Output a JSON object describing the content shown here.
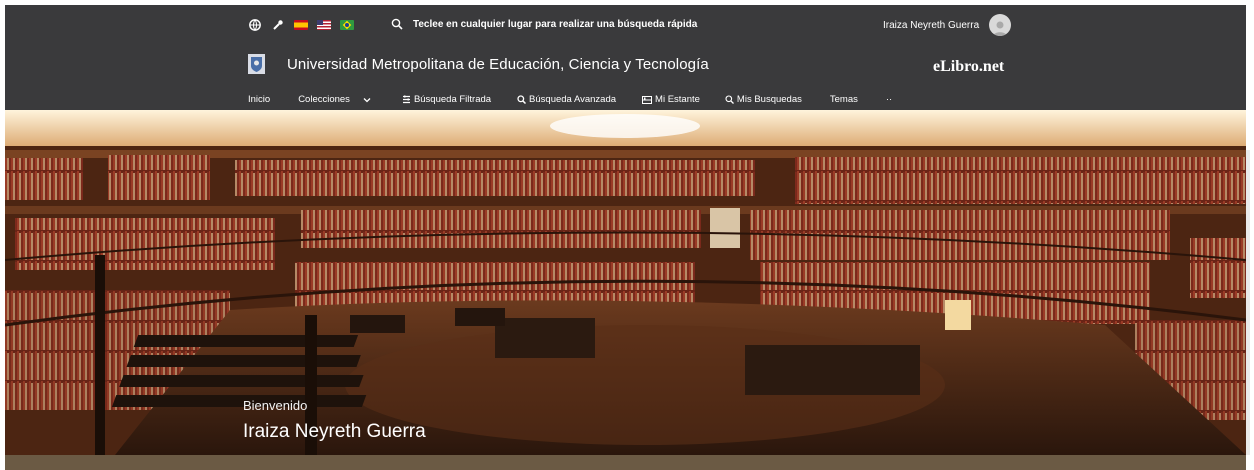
{
  "header": {
    "search_text": "Teclee en cualquier lugar para realizar una búsqueda rápida",
    "user_name": "Iraiza Neyreth Guerra",
    "university_name": "Universidad Metropolitana de Educación, Ciencia y Tecnología",
    "brand": "eLibro.net",
    "languages": [
      "es",
      "en",
      "pt"
    ]
  },
  "nav": {
    "items": [
      {
        "label": "Inicio",
        "icon": ""
      },
      {
        "label": "Colecciones",
        "icon": "chevron-down-icon"
      },
      {
        "label": "Búsqueda Filtrada",
        "icon": "filter-icon"
      },
      {
        "label": "Búsqueda Avanzada",
        "icon": "search-icon"
      },
      {
        "label": "Mi Estante",
        "icon": "shelf-icon"
      },
      {
        "label": "Mis Busquedas",
        "icon": "search-icon"
      },
      {
        "label": "Temas",
        "icon": ""
      },
      {
        "label": "··",
        "icon": ""
      }
    ]
  },
  "hero": {
    "welcome": "Bienvenido",
    "user_name": "Iraiza Neyreth Guerra"
  },
  "colors": {
    "header_bg": "#3a3a3c",
    "text": "#ffffff",
    "hero_wood": "#5a2c14",
    "hero_books": "#8a2a1e"
  }
}
